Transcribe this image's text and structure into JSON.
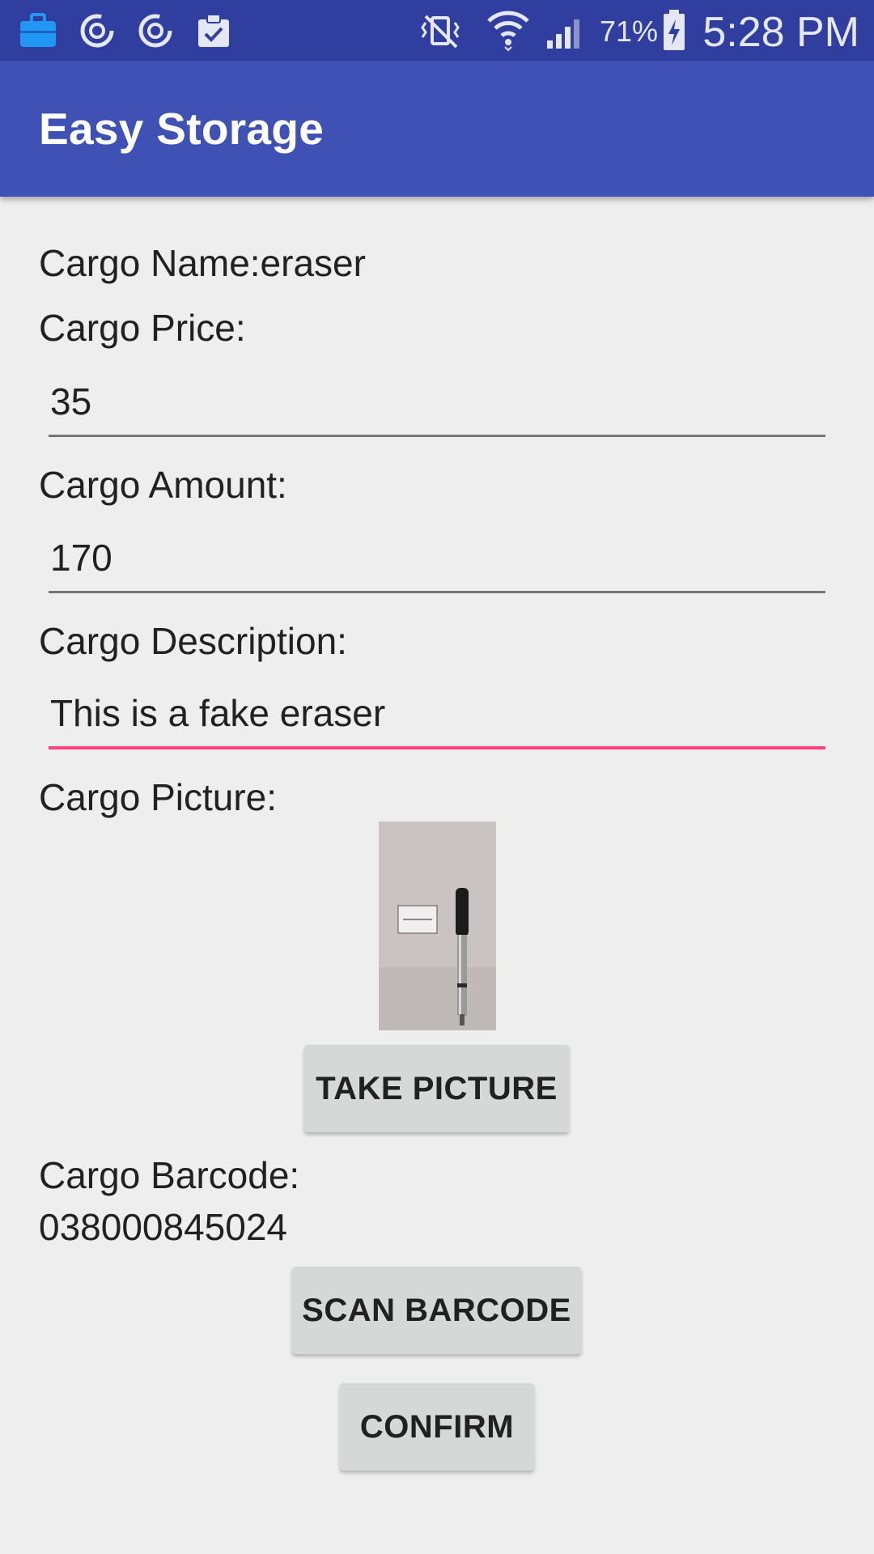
{
  "status_bar": {
    "icons_left": [
      "briefcase-icon",
      "sync-icon",
      "sync-icon",
      "clipboard-check-icon"
    ],
    "icons_right": [
      "vibrate-mute-icon",
      "wifi-icon",
      "signal-icon",
      "battery-charging-icon"
    ],
    "battery_percent": "71%",
    "time": "5:28 PM"
  },
  "app_bar": {
    "title": "Easy Storage"
  },
  "form": {
    "name_label": "Cargo Name:eraser",
    "price_label": "Cargo Price:",
    "price_value": "35",
    "amount_label": "Cargo Amount:",
    "amount_value": "170",
    "description_label": "Cargo Description:",
    "description_value": "This is a fake eraser",
    "picture_label": "Cargo Picture:",
    "take_picture_button": "TAKE PICTURE",
    "barcode_label": "Cargo Barcode:",
    "barcode_value": "038000845024",
    "scan_barcode_button": "SCAN BARCODE",
    "confirm_button": "CONFIRM"
  },
  "colors": {
    "status_bar": "#303f9f",
    "app_bar": "#3f51b5",
    "accent": "#ff4081",
    "background": "#eeeeee",
    "button": "#d6d7d7"
  }
}
